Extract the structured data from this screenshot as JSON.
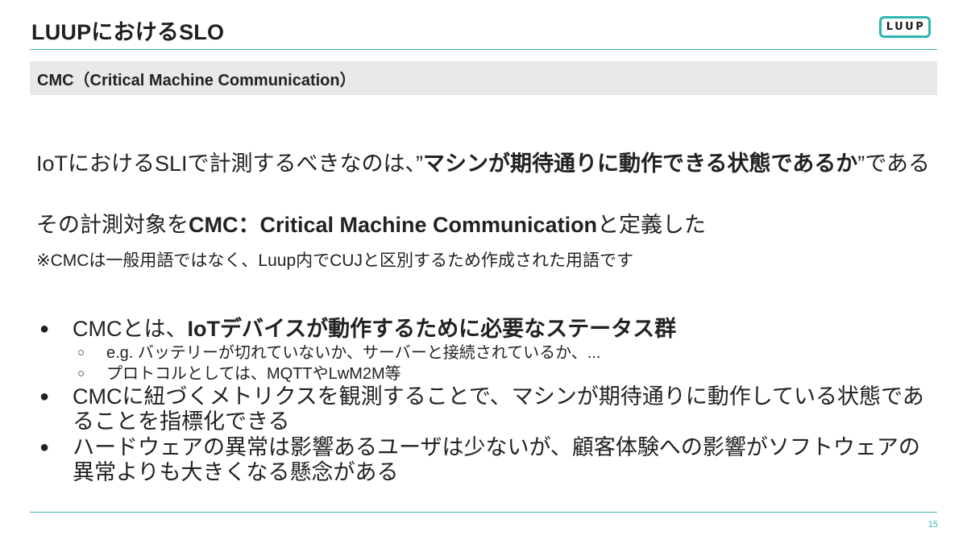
{
  "header": {
    "title": "LUUPにおけるSLO",
    "logo_text": "LUUP"
  },
  "section": {
    "label": "CMC（Critical Machine Communication）"
  },
  "body": {
    "lead_prefix": "IoTにおけるSLIで計測するべきなのは、”",
    "lead_bold": "マシンが期待通りに動作できる状態であるか",
    "lead_suffix": "”である",
    "def_prefix": "その計測対象を",
    "def_bold": "CMC：Critical Machine Communication",
    "def_suffix": "と定義した",
    "note": "※CMCは一般用語ではなく、Luup内でCUJと区別するため作成された用語です"
  },
  "bullets": [
    {
      "marker": "●",
      "prefix": "CMCとは、",
      "bold": "IoTデバイスが動作するために必要なステータス群",
      "subs": [
        {
          "marker": "○",
          "text": "e.g. バッテリーが切れていないか、サーバーと接続されているか、..."
        },
        {
          "marker": "○",
          "text": "プロトコルとしては、MQTTやLwM2M等"
        }
      ]
    },
    {
      "marker": "●",
      "text": "CMCに紐づくメトリクスを観測することで、マシンが期待通りに動作している状態であることを指標化できる"
    },
    {
      "marker": "●",
      "text": "ハードウェアの異常は影響あるユーザは少ないが、顧客体験への影響がソフトウェアの異常よりも大きくなる懸念がある"
    }
  ],
  "footer": {
    "page_number": "15"
  },
  "colors": {
    "accent": "#2bb8b0",
    "section_bg": "#e9e9e9",
    "text": "#222222"
  }
}
